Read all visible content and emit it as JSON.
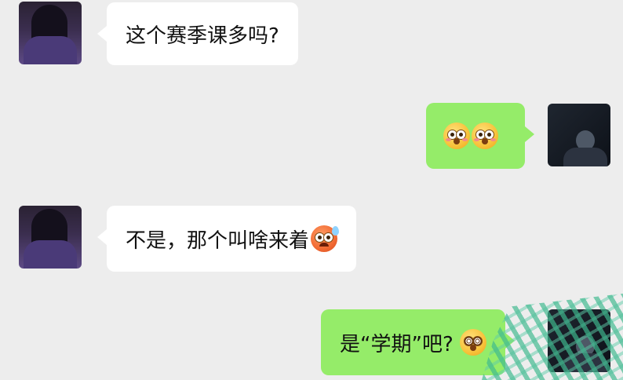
{
  "chat": {
    "messages": [
      {
        "side": "left",
        "text": "这个赛季课多吗?",
        "avatar": "girl-avatar"
      },
      {
        "side": "right",
        "text": "",
        "emojis": [
          "flushed-face-emoji",
          "flushed-face-emoji"
        ],
        "avatar": "boy-avatar"
      },
      {
        "side": "left",
        "text": "不是，那个叫啥来着",
        "emojis": [
          "hot-face-emoji"
        ],
        "avatar": "girl-avatar"
      },
      {
        "side": "right",
        "text": "是“学期”吧?",
        "emojis": [
          "dizzy-face-emoji"
        ],
        "avatar": "boy-avatar"
      }
    ]
  },
  "colors": {
    "background": "#ededed",
    "incoming_bubble": "#ffffff",
    "outgoing_bubble": "#95ec69",
    "scribble": "#3fb98f"
  }
}
